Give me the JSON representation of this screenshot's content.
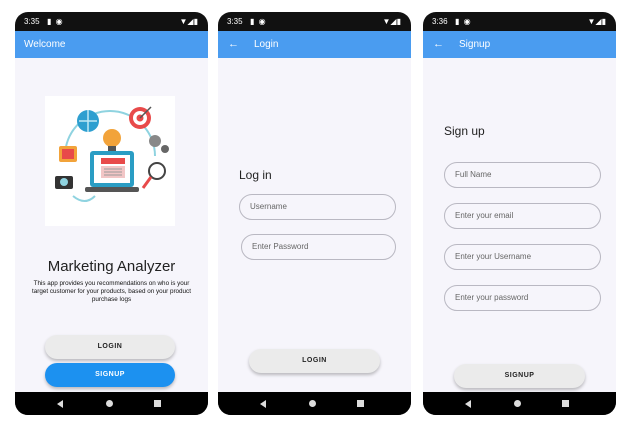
{
  "welcome": {
    "status": {
      "time": "3:35"
    },
    "appbar_title": "Welcome",
    "app_name": "Marketing Analyzer",
    "description": "This app provides you recommendations on who is your target customer for your products, based on your product purchase logs",
    "login_label": "LOGIN",
    "signup_label": "SIGNUP"
  },
  "login": {
    "status": {
      "time": "3:35"
    },
    "appbar_title": "Login",
    "heading": "Log in",
    "username_placeholder": "Username",
    "password_placeholder": "Enter Password",
    "login_label": "LOGIN"
  },
  "signup": {
    "status": {
      "time": "3:36"
    },
    "appbar_title": "Signup",
    "heading": "Sign up",
    "fullname_placeholder": "Full Name",
    "email_placeholder": "Enter your email",
    "username_placeholder": "Enter your Username",
    "password_placeholder": "Enter your password",
    "signup_label": "SIGNUP"
  },
  "colors": {
    "appbar": "#4a9cf0",
    "primary_button": "#1c91f0",
    "background": "#f6f5fb"
  }
}
